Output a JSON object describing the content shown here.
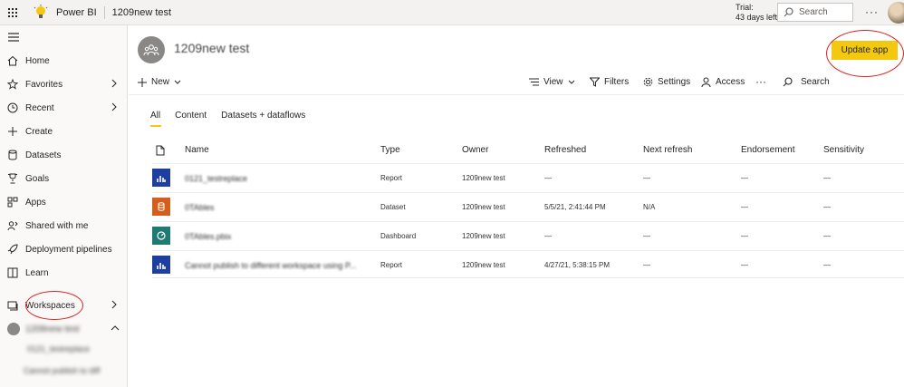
{
  "topbar": {
    "app_name": "Power BI",
    "workspace_title": "1209new test",
    "trial_line1": "Trial:",
    "trial_line2": "43 days left",
    "search_placeholder": "Search",
    "more": "···"
  },
  "sidebar": {
    "items": [
      {
        "label": "Home",
        "icon": "home-icon"
      },
      {
        "label": "Favorites",
        "icon": "star-icon"
      },
      {
        "label": "Recent",
        "icon": "clock-icon"
      },
      {
        "label": "Create",
        "icon": "plus-icon"
      },
      {
        "label": "Datasets",
        "icon": "database-icon"
      },
      {
        "label": "Goals",
        "icon": "trophy-icon"
      },
      {
        "label": "Apps",
        "icon": "apps-icon"
      },
      {
        "label": "Shared with me",
        "icon": "person-share-icon"
      },
      {
        "label": "Deployment pipelines",
        "icon": "rocket-icon"
      },
      {
        "label": "Learn",
        "icon": "book-icon"
      },
      {
        "label": "Workspaces",
        "icon": "workspaces-icon"
      }
    ],
    "current_workspace": "1209new test",
    "sub_items": [
      "0121_testreplace",
      "Cannot publish to diff"
    ]
  },
  "header": {
    "workspace_name": "1209new test",
    "update_button": "Update app"
  },
  "toolbar": {
    "new": "New",
    "view": "View",
    "filters": "Filters",
    "settings": "Settings",
    "access": "Access",
    "more": "···",
    "search": "Search"
  },
  "tabs": [
    "All",
    "Content",
    "Datasets + dataflows"
  ],
  "table": {
    "columns": [
      "Name",
      "Type",
      "Owner",
      "Refreshed",
      "Next refresh",
      "Endorsement",
      "Sensitivity"
    ],
    "rows": [
      {
        "name": "0121_testreplace",
        "type": "Report",
        "owner": "1209new test",
        "refreshed": "—",
        "next": "—",
        "endorsement": "—",
        "sensitivity": "—",
        "icon": "report-icon",
        "color": "#1e3f9e"
      },
      {
        "name": "0TAbles",
        "type": "Dataset",
        "owner": "1209new test",
        "refreshed": "5/5/21, 2:41:44 PM",
        "next": "N/A",
        "endorsement": "—",
        "sensitivity": "—",
        "icon": "dataset-icon",
        "color": "#d35e1d"
      },
      {
        "name": "0TAbles.pbix",
        "type": "Dashboard",
        "owner": "1209new test",
        "refreshed": "—",
        "next": "—",
        "endorsement": "—",
        "sensitivity": "—",
        "icon": "dashboard-icon",
        "color": "#1f7a72"
      },
      {
        "name": "Cannot publish to different workspace using P...",
        "type": "Report",
        "owner": "1209new test",
        "refreshed": "4/27/21, 5:38:15 PM",
        "next": "—",
        "endorsement": "—",
        "sensitivity": "—",
        "icon": "report-icon",
        "color": "#1e3f9e"
      }
    ]
  },
  "colors": {
    "accent": "#f2c811",
    "annotation": "#e02020"
  }
}
